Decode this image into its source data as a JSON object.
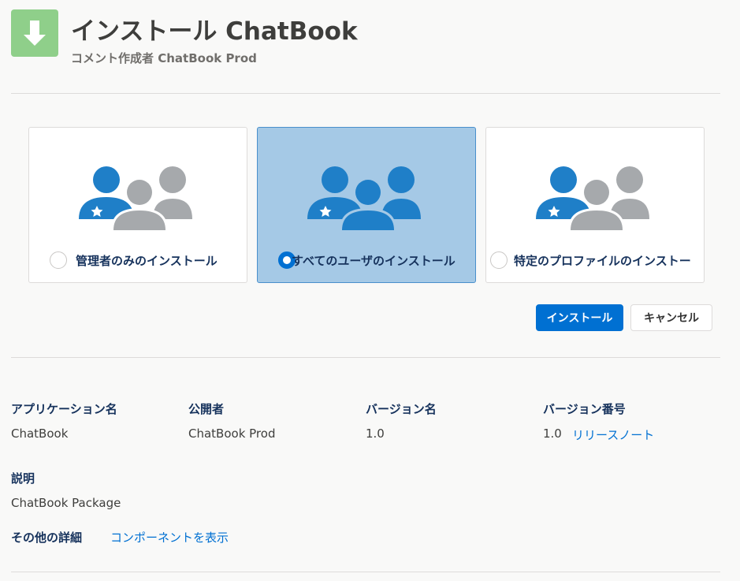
{
  "header": {
    "title": "インストール ChatBook",
    "subtitle": "コメント作成者 ChatBook Prod",
    "icon": "download-arrow-icon"
  },
  "install_options": [
    {
      "label": "管理者のみのインストール",
      "selected": false
    },
    {
      "label": "すべてのユーザのインストール",
      "selected": true
    },
    {
      "label": "特定のプロファイルのインストー",
      "selected": false
    }
  ],
  "buttons": {
    "install": "インストール",
    "cancel": "キャンセル"
  },
  "details": {
    "app_name_label": "アプリケーション名",
    "app_name": "ChatBook",
    "publisher_label": "公開者",
    "publisher": "ChatBook Prod",
    "version_name_label": "バージョン名",
    "version_name": "1.0",
    "version_number_label": "バージョン番号",
    "version_number": "1.0",
    "release_notes_link": "リリースノート",
    "description_label": "説明",
    "description": "ChatBook Package",
    "other_details_label": "その他の詳細",
    "view_components_link": "コンポーネントを表示"
  },
  "colors": {
    "accent": "#0070d2",
    "selected_bg": "#a5c9e6",
    "icon_green": "#8fcf8a",
    "user_blue": "#1f7fc8",
    "user_gray": "#a6a9ac"
  }
}
